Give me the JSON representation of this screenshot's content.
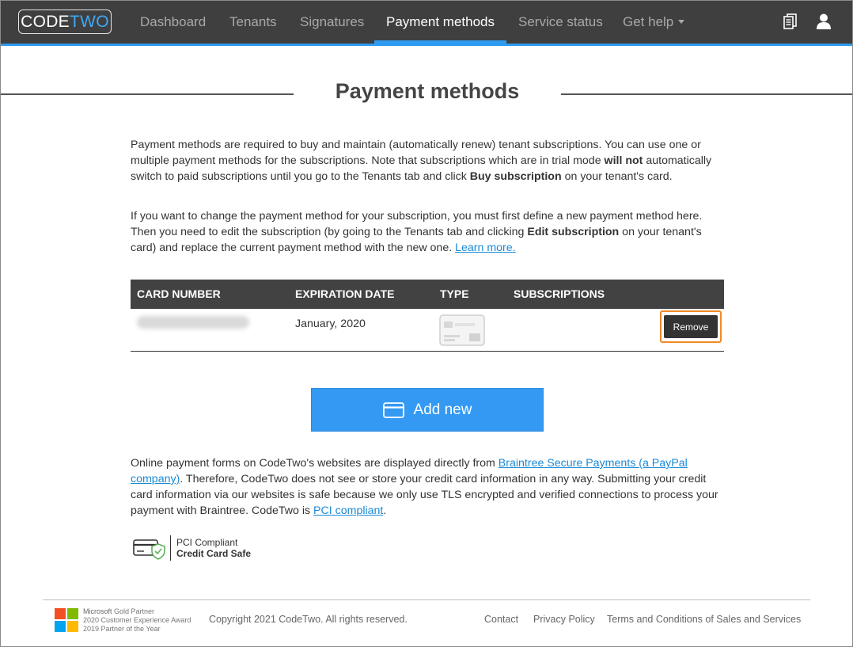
{
  "nav": {
    "logo_code": "CODE",
    "logo_two": "TWO",
    "items": [
      {
        "label": "Dashboard"
      },
      {
        "label": "Tenants"
      },
      {
        "label": "Signatures"
      },
      {
        "label": "Payment methods"
      },
      {
        "label": "Service status"
      },
      {
        "label": "Get help"
      }
    ],
    "active_index": 3,
    "accent_color": "#2e9bf0",
    "icons": [
      "document-icon",
      "user-icon"
    ]
  },
  "page": {
    "title": "Payment methods",
    "para1": {
      "t1": "Payment methods are required to buy and maintain (automatically renew) tenant subscriptions. You can use one or multiple payment methods for the subscriptions. Note that subscriptions which are in trial mode ",
      "b1": "will not",
      "t2": " automatically switch to paid subscriptions until you go to the Tenants tab and click ",
      "b2": "Buy subscription",
      "t3": " on your tenant's card."
    },
    "para2": {
      "t1": "If you want to change the payment method for your subscription, you must first define a new payment method here. Then you need to edit the subscription (by going to the Tenants tab and clicking ",
      "b1": "Edit subscription",
      "t2": " on your tenant's card) and replace the current payment method with the new one. ",
      "link": "Learn more."
    }
  },
  "table": {
    "headers": [
      "CARD NUMBER",
      "EXPIRATION DATE",
      "TYPE",
      "SUBSCRIPTIONS"
    ],
    "rows": [
      {
        "card_number": "",
        "expiration": "January, 2020",
        "type_icon": "credit-card-icon",
        "subscriptions": "",
        "action": "Remove"
      }
    ]
  },
  "add_button": {
    "label": "Add new",
    "icon": "credit-card-icon",
    "color": "#3399f3"
  },
  "security_note": {
    "t1": "Online payment forms on CodeTwo's websites are displayed directly from ",
    "link1": "Braintree Secure Payments (a PayPal company)",
    "t2": ". Therefore, CodeTwo does not see or store your credit card information in any way. Submitting your credit card information via our websites is safe because we only use TLS encrypted and verified connections to process your payment with Braintree. CodeTwo is ",
    "link2": "PCI compliant",
    "t3": "."
  },
  "pci_badge": {
    "line1": "PCI Compliant",
    "line2": "Credit Card Safe"
  },
  "footer": {
    "ms_line1_brand": "Microsoft",
    "ms_line1_rest": " Gold Partner",
    "ms_line2": "2020 Customer Experience Award",
    "ms_line3": "2019 Partner of the Year",
    "copyright": "Copyright 2021 CodeTwo. All rights reserved.",
    "links": [
      "Contact",
      "Privacy Policy",
      "Terms and Conditions of Sales and Services"
    ]
  }
}
